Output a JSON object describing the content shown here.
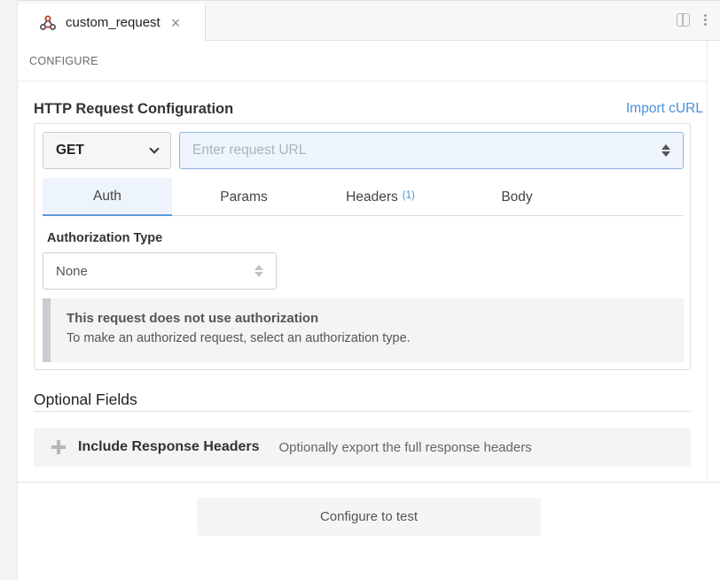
{
  "tab": {
    "title": "custom_request",
    "close": "×",
    "icon": "webhook-icon"
  },
  "section": {
    "label": "CONFIGURE"
  },
  "http": {
    "title": "HTTP Request Configuration",
    "import_label": "Import cURL",
    "method": "GET",
    "url_value": "",
    "url_placeholder": "Enter request URL"
  },
  "request_tabs": [
    {
      "label": "Auth",
      "active": true
    },
    {
      "label": "Params"
    },
    {
      "label": "Headers",
      "badge": "(1)"
    },
    {
      "label": "Body"
    }
  ],
  "auth": {
    "label": "Authorization Type",
    "selected": "None",
    "notice_title": "This request does not use authorization",
    "notice_text": "To make an authorized request, select an authorization type."
  },
  "optional": {
    "title": "Optional Fields",
    "include_headers_label": "Include Response Headers",
    "include_headers_desc": "Optionally export the full response headers"
  },
  "footer": {
    "button_label": "Configure to test"
  },
  "colors": {
    "accent": "#4a90d9",
    "tab_active_bg": "#eef4fb",
    "url_border": "#8fb7e6",
    "logo": "#c0392b"
  }
}
